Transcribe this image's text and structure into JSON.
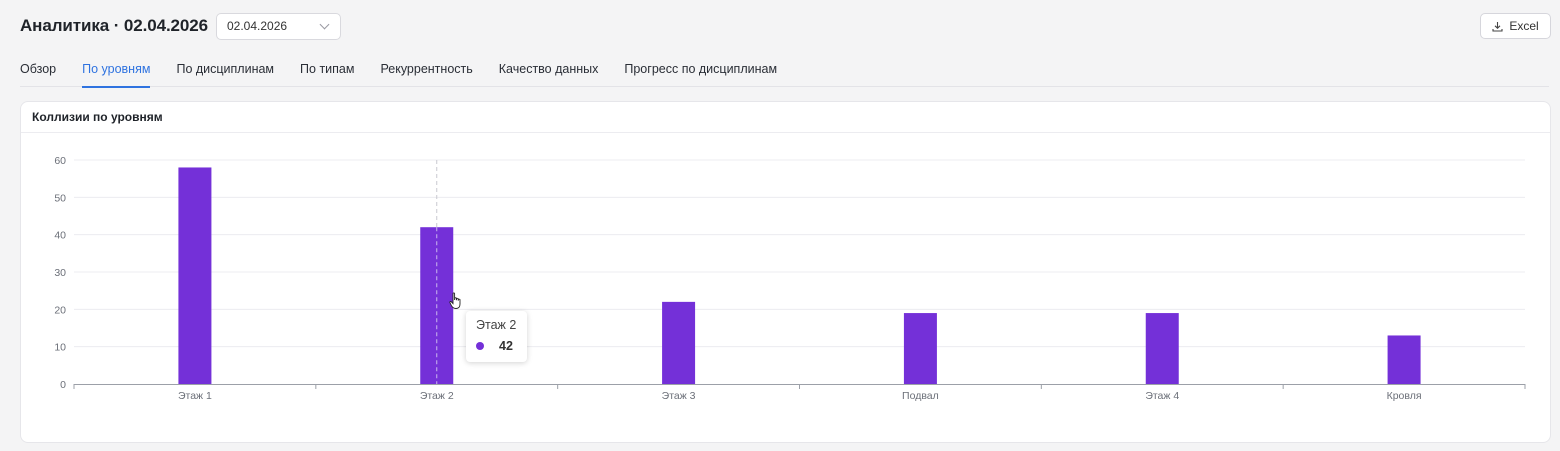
{
  "header": {
    "title": "Аналитика · 02.04.2026",
    "date_value": "02.04.2026",
    "excel_label": "Excel"
  },
  "tabs": [
    {
      "label": "Обзор",
      "active": false
    },
    {
      "label": "По уровням",
      "active": true
    },
    {
      "label": "По дисциплинам",
      "active": false
    },
    {
      "label": "По типам",
      "active": false
    },
    {
      "label": "Рекуррентность",
      "active": false
    },
    {
      "label": "Качество данных",
      "active": false
    },
    {
      "label": "Прогресс по дисциплинам",
      "active": false
    }
  ],
  "card": {
    "title": "Коллизии по уровням"
  },
  "colors": {
    "accent": "#2f73e0",
    "bar": "#7430d8"
  },
  "chart_data": {
    "type": "bar",
    "categories": [
      "Этаж 1",
      "Этаж 2",
      "Этаж 3",
      "Подвал",
      "Этаж 4",
      "Кровля"
    ],
    "values": [
      58,
      42,
      22,
      19,
      19,
      13
    ],
    "ylim": [
      0,
      60
    ],
    "yticks": [
      0,
      10,
      20,
      30,
      40,
      50,
      60
    ],
    "grid": true,
    "legend": "none"
  },
  "tooltip": {
    "title": "Этаж 2",
    "value": "42"
  }
}
